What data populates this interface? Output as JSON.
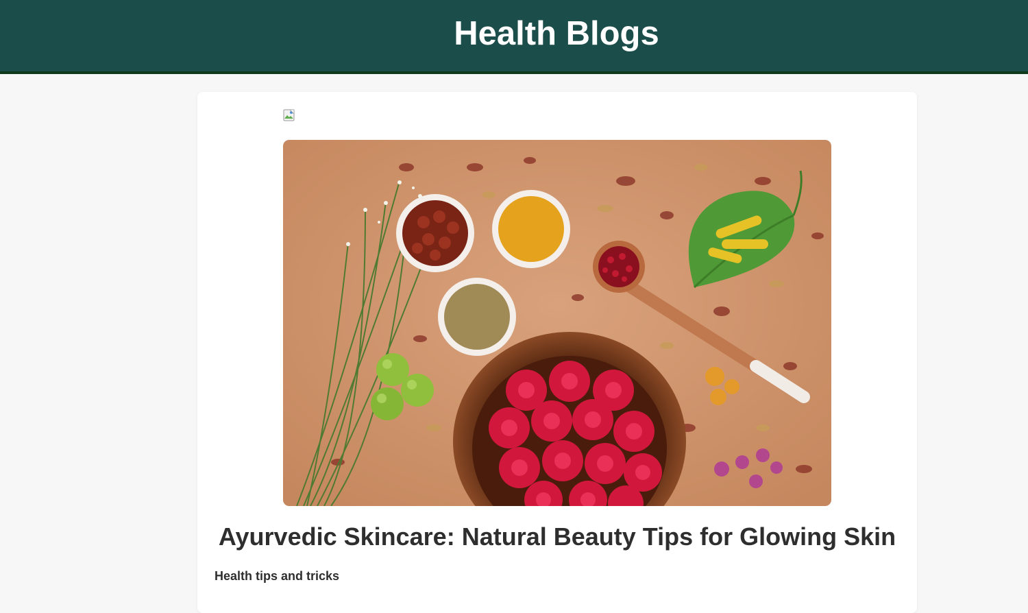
{
  "header": {
    "title": "Health Blogs",
    "background_color": "#1b4d4a",
    "border_color": "#0f3a1c"
  },
  "post": {
    "broken_image_icon": "broken-image-icon",
    "hero_image": "ayurvedic-ingredients-photo",
    "title": "Ayurvedic Skincare: Natural Beauty Tips for Glowing Skin",
    "category": "Health tips and tricks"
  }
}
